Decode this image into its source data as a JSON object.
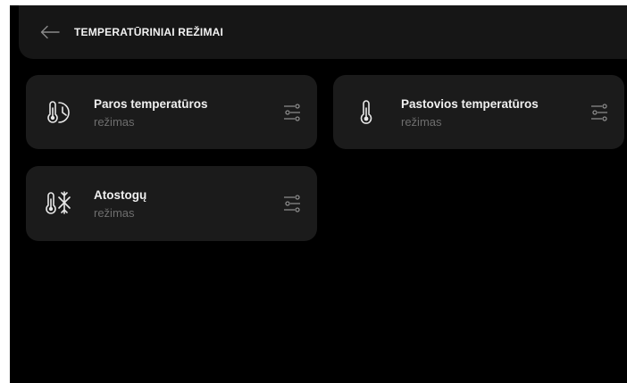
{
  "header": {
    "title": "TEMPERATŪRINIAI REŽIMAI"
  },
  "modes": [
    {
      "title": "Paros temperatūros",
      "subtitle": "režimas",
      "icon": "thermometer-clock-icon"
    },
    {
      "title": "Pastovios temperatūros",
      "subtitle": "režimas",
      "icon": "thermometer-icon"
    },
    {
      "title": "Atostogų",
      "subtitle": "režimas",
      "icon": "thermometer-snowflake-icon"
    }
  ],
  "colors": {
    "background": "#000000",
    "header": "#161616",
    "card": "#1b1b1b",
    "text": "#f0f0f0",
    "muted": "#6e6e6e"
  }
}
